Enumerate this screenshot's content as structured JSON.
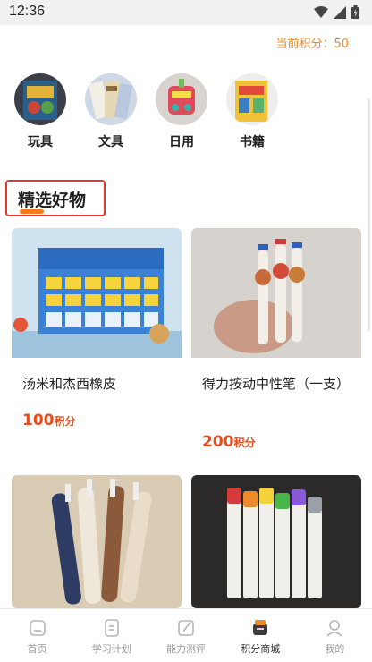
{
  "status": {
    "time": "12:36"
  },
  "points": {
    "label": "当前积分：",
    "value": "50"
  },
  "categories": [
    {
      "label": "玩具",
      "icon": "toys-image"
    },
    {
      "label": "文具",
      "icon": "stationery-image"
    },
    {
      "label": "日用",
      "icon": "daily-goods-image"
    },
    {
      "label": "书籍",
      "icon": "books-image"
    }
  ],
  "section": {
    "title": "精选好物"
  },
  "products": [
    {
      "name": "汤米和杰西橡皮",
      "price": "100",
      "unit": "积分"
    },
    {
      "name": "得力按动中性笔（一支）",
      "price": "200",
      "unit": "积分"
    },
    {
      "name": "",
      "price": "",
      "unit": ""
    },
    {
      "name": "",
      "price": "",
      "unit": ""
    }
  ],
  "nav": [
    {
      "label": "首页",
      "icon": "home-icon",
      "active": false
    },
    {
      "label": "学习计划",
      "icon": "study-plan-icon",
      "active": false
    },
    {
      "label": "能力测评",
      "icon": "assessment-icon",
      "active": false
    },
    {
      "label": "积分商城",
      "icon": "points-mall-icon",
      "active": true
    },
    {
      "label": "我的",
      "icon": "profile-icon",
      "active": false
    }
  ],
  "colors": {
    "accent": "#f08a24",
    "price": "#ee4a15",
    "highlight_border": "#e03a2f"
  }
}
